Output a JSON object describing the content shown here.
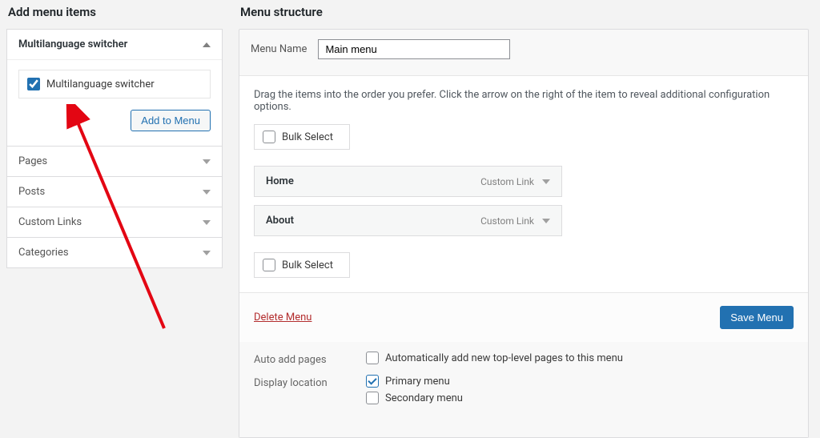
{
  "left": {
    "heading": "Add menu items",
    "panels": [
      {
        "key": "mls",
        "label": "Multilanguage switcher",
        "expanded": true
      },
      {
        "key": "pages",
        "label": "Pages",
        "expanded": false
      },
      {
        "key": "posts",
        "label": "Posts",
        "expanded": false
      },
      {
        "key": "custom-links",
        "label": "Custom Links",
        "expanded": false
      },
      {
        "key": "categories",
        "label": "Categories",
        "expanded": false
      }
    ],
    "mls_checkbox_label": "Multilanguage switcher",
    "mls_checked": true,
    "add_to_menu": "Add to Menu"
  },
  "right": {
    "heading": "Menu structure",
    "menu_name_label": "Menu Name",
    "menu_name_value": "Main menu",
    "hint": "Drag the items into the order you prefer. Click the arrow on the right of the item to reveal additional configuration options.",
    "bulk_select": "Bulk Select",
    "items": [
      {
        "name": "Home",
        "type": "Custom Link"
      },
      {
        "name": "About",
        "type": "Custom Link"
      }
    ],
    "delete_menu": "Delete Menu",
    "save_menu": "Save Menu",
    "settings": {
      "auto_add_label": "Auto add pages",
      "auto_add_cb": "Automatically add new top-level pages to this menu",
      "auto_add_checked": false,
      "display_loc_label": "Display location",
      "primary_label": "Primary menu",
      "primary_checked": true,
      "secondary_label": "Secondary menu",
      "secondary_checked": false
    }
  }
}
